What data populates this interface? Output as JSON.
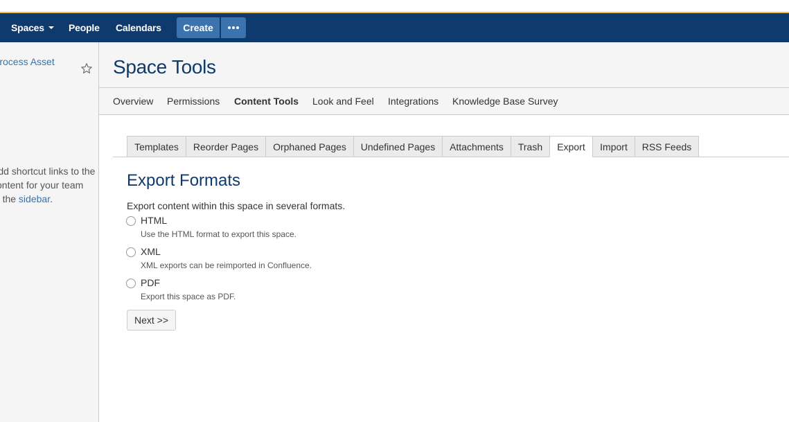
{
  "colors": {
    "navbar_bg": "#0f3a6e",
    "create_button_bg": "#3b73af",
    "link": "#3572b0",
    "title": "#0f3a6e"
  },
  "navbar": {
    "spaces_label": "Spaces",
    "people_label": "People",
    "calendars_label": "Calendars",
    "create_label": "Create",
    "more_icon": "more-dots-icon"
  },
  "sidebar": {
    "space_name": "Process Asset",
    "star_icon": "star-icon",
    "message_lines": [
      "Add shortcut links to the",
      "content for your team",
      "to the sidebar."
    ],
    "message_link": "sidebar"
  },
  "page": {
    "title": "Space Tools"
  },
  "subnav": {
    "items": [
      "Overview",
      "Permissions",
      "Content Tools",
      "Look and Feel",
      "Integrations",
      "Knowledge Base Survey"
    ],
    "active": "Content Tools"
  },
  "tabs": {
    "items": [
      "Templates",
      "Reorder Pages",
      "Orphaned Pages",
      "Undefined Pages",
      "Attachments",
      "Trash",
      "Export",
      "Import",
      "RSS Feeds"
    ],
    "active": "Export"
  },
  "export": {
    "heading": "Export Formats",
    "description": "Export content within this space in several formats.",
    "options": [
      {
        "label": "HTML",
        "help": "Use the HTML format to export this space.",
        "selected": false
      },
      {
        "label": "XML",
        "help": "XML exports can be reimported in Confluence.",
        "selected": false
      },
      {
        "label": "PDF",
        "help": "Export this space as PDF.",
        "selected": false
      }
    ],
    "next_label": "Next >>"
  }
}
